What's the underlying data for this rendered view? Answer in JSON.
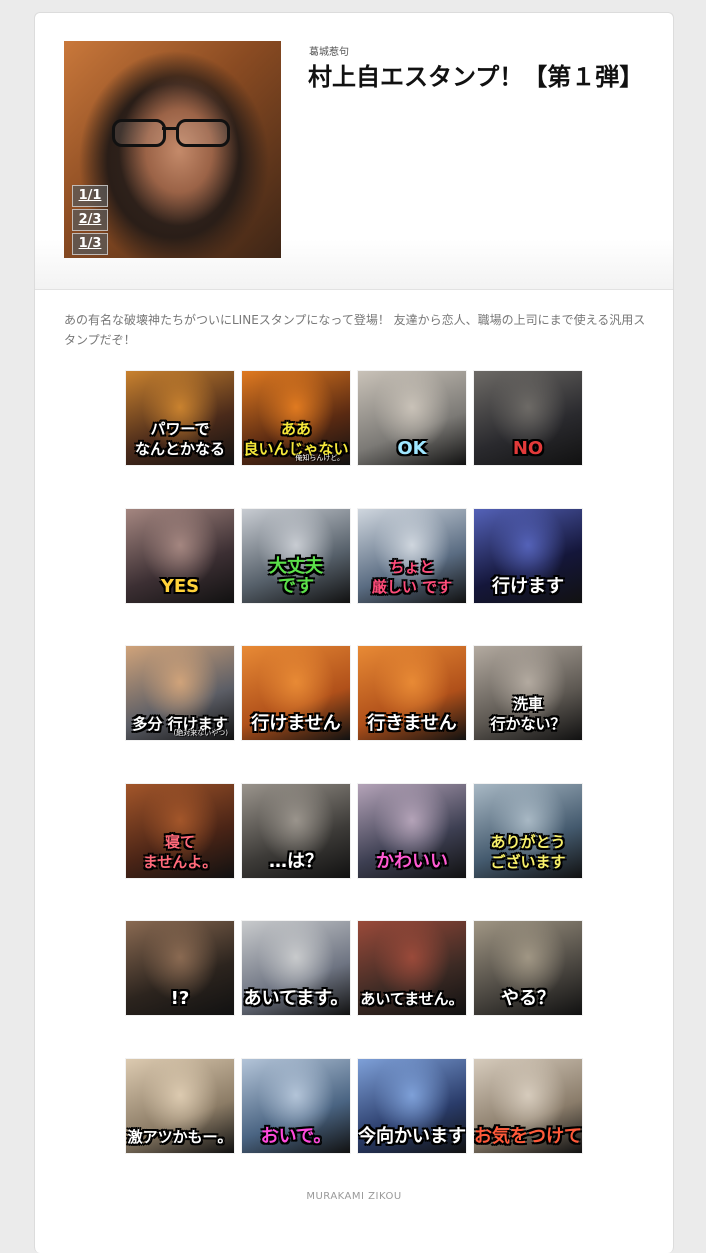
{
  "header": {
    "author": "葛城惹句",
    "title": "村上自エスタンプ！【第１弾】",
    "page_badges": [
      "1/1",
      "2/3",
      "1/3"
    ]
  },
  "description": "あの有名な破壊神たちがついにLINEスタンプになって登場！ 友達から恋人、職場の上司にまで使える汎用スタンプだぞ！",
  "stickers": [
    {
      "text": "パワーで\nなんとかなる",
      "sub": "",
      "bg": "#4a2a1a",
      "accent": "#c9822f",
      "color": "#ffffff"
    },
    {
      "text": "ああ\n良いんじゃない",
      "sub": "俺知らんけど。",
      "bg": "#5a2a12",
      "accent": "#e07a20",
      "color": "#f5e83a"
    },
    {
      "text": "OK",
      "sub": "",
      "bg": "#7c7a76",
      "accent": "#c9c2b8",
      "color": "#9fe6ff"
    },
    {
      "text": "NO",
      "sub": "",
      "bg": "#2a2a2e",
      "accent": "#6d6a66",
      "color": "#e23a3a"
    },
    {
      "text": "YES",
      "sub": "",
      "bg": "#3c2f33",
      "accent": "#a48680",
      "color": "#ffd23a"
    },
    {
      "text": "大丈夫\nです",
      "sub": "",
      "bg": "#56606a",
      "accent": "#c8ccd2",
      "color": "#5be04a"
    },
    {
      "text": "ちょと\n厳しい です",
      "sub": "",
      "bg": "#5a6c82",
      "accent": "#cfd6de",
      "color": "#ff4c7a"
    },
    {
      "text": "行けます",
      "sub": "",
      "bg": "#14163a",
      "accent": "#5462b8",
      "color": "#ffffff"
    },
    {
      "text": "多分 行けます",
      "sub": "(絶対来ないやつ)",
      "bg": "#5c5e66",
      "accent": "#d0a37a",
      "color": "#ffffff"
    },
    {
      "text": "行けません",
      "sub": "",
      "bg": "#b0501a",
      "accent": "#e88a35",
      "color": "#ffffff"
    },
    {
      "text": "行きません",
      "sub": "",
      "bg": "#b0501a",
      "accent": "#e88a35",
      "color": "#ffffff"
    },
    {
      "text": "洗車\n行かない？",
      "sub": "",
      "bg": "#5d5852",
      "accent": "#b3aaa0",
      "color": "#ffffff"
    },
    {
      "text": "寝て\nませんよ。",
      "sub": "",
      "bg": "#4a2416",
      "accent": "#a3562a",
      "color": "#ff6a7a"
    },
    {
      "text": "…は？",
      "sub": "",
      "bg": "#3d3b38",
      "accent": "#9a948c",
      "color": "#ffffff"
    },
    {
      "text": "かわいい",
      "sub": "",
      "bg": "#3d3f52",
      "accent": "#b4a3b8",
      "color": "#ff5ad2"
    },
    {
      "text": "ありがとう\nございます",
      "sub": "",
      "bg": "#445a6e",
      "accent": "#a8b8c4",
      "color": "#f8f06a"
    },
    {
      "text": "!?",
      "sub": "",
      "bg": "#2c241e",
      "accent": "#8a6a52",
      "color": "#ffffff"
    },
    {
      "text": "あいてます。",
      "sub": "",
      "bg": "#6e7482",
      "accent": "#c8cacc",
      "color": "#ffffff"
    },
    {
      "text": "あいてません。",
      "sub": "",
      "bg": "#3c2a24",
      "accent": "#9a4a3a",
      "color": "#ffffff"
    },
    {
      "text": "やる？",
      "sub": "",
      "bg": "#4a4640",
      "accent": "#a09684",
      "color": "#ffffff"
    },
    {
      "text": "激アツかもー。",
      "sub": "",
      "bg": "#8c7c66",
      "accent": "#dccab0",
      "color": "#ffffff"
    },
    {
      "text": "おいで。",
      "sub": "",
      "bg": "#4a6482",
      "accent": "#b3c4d8",
      "color": "#ff4adc"
    },
    {
      "text": "今向かいます",
      "sub": "",
      "bg": "#2a3c6a",
      "accent": "#7ea0d8",
      "color": "#ffffff"
    },
    {
      "text": "お気をつけて",
      "sub": "",
      "bg": "#8a7c6a",
      "accent": "#d6cbbc",
      "color": "#ff5a3a"
    }
  ],
  "footer": "MURAKAMI ZIKOU"
}
